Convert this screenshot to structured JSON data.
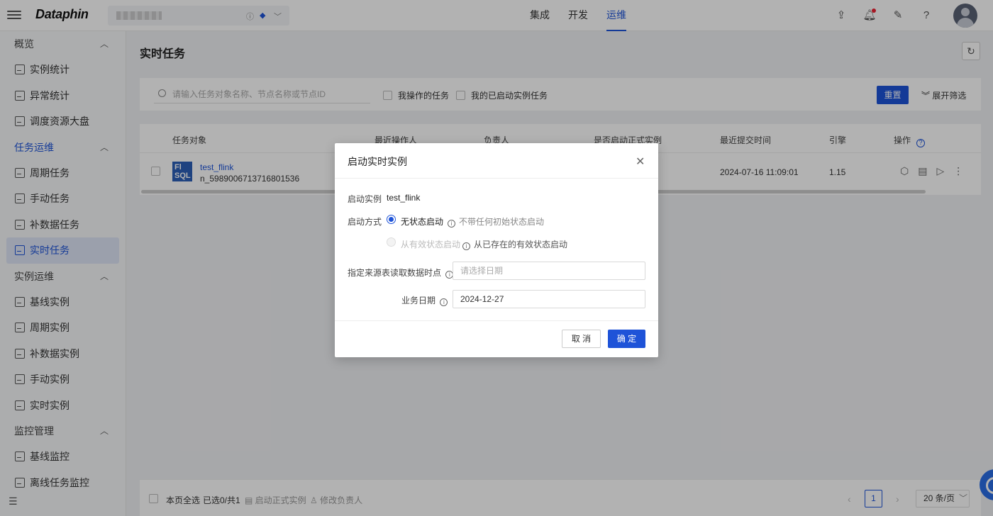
{
  "app": {
    "logo": "Dataphin"
  },
  "topnav": {
    "items": [
      "集成",
      "开发",
      "运维"
    ],
    "active": "运维"
  },
  "sidebar": {
    "groups": [
      {
        "label": "概览",
        "items": [
          "实例统计",
          "异常统计",
          "调度资源大盘"
        ]
      },
      {
        "label": "任务运维",
        "items": [
          "周期任务",
          "手动任务",
          "补数据任务",
          "实时任务"
        ]
      },
      {
        "label": "实例运维",
        "items": [
          "基线实例",
          "周期实例",
          "补数据实例",
          "手动实例",
          "实时实例"
        ]
      },
      {
        "label": "监控管理",
        "items": [
          "基线监控",
          "离线任务监控"
        ]
      }
    ],
    "active_item": "实时任务"
  },
  "page": {
    "title": "实时任务"
  },
  "filter": {
    "search_placeholder": "请输入任务对象名称、节点名称或节点ID",
    "check_mine": "我操作的任务",
    "check_started": "我的已启动实例任务",
    "reset": "重置",
    "expand": "展开筛选"
  },
  "table": {
    "headers": [
      "任务对象",
      "最近操作人",
      "负责人",
      "是否启动正式实例",
      "最近提交时间",
      "引擎",
      "操作"
    ],
    "rows": [
      {
        "icon_text": "Fl SQL",
        "name": "test_flink",
        "node_id": "n_5989006713716801536",
        "submit_time": "2024-07-16 11:09:01",
        "engine": "1.15"
      }
    ]
  },
  "footer": {
    "select_all": "本页全选",
    "selected": "已选0/共1",
    "start_formal": "启动正式实例",
    "change_owner": "修改负责人",
    "page": "1",
    "page_size": "20 条/页"
  },
  "modal": {
    "title": "启动实时实例",
    "instance_label": "启动实例",
    "instance_value": "test_flink",
    "mode_label": "启动方式",
    "opt1": "无状态启动",
    "opt1_hint": "不带任何初始状态启动",
    "opt2": "从有效状态启动",
    "opt2_hint": "从已存在的有效状态启动",
    "source_label": "指定来源表读取数据时点",
    "source_placeholder": "请选择日期",
    "biz_label": "业务日期",
    "biz_value": "2024-12-27",
    "cancel": "取 消",
    "ok": "确 定"
  },
  "colors": {
    "primary": "#1e53d8"
  }
}
